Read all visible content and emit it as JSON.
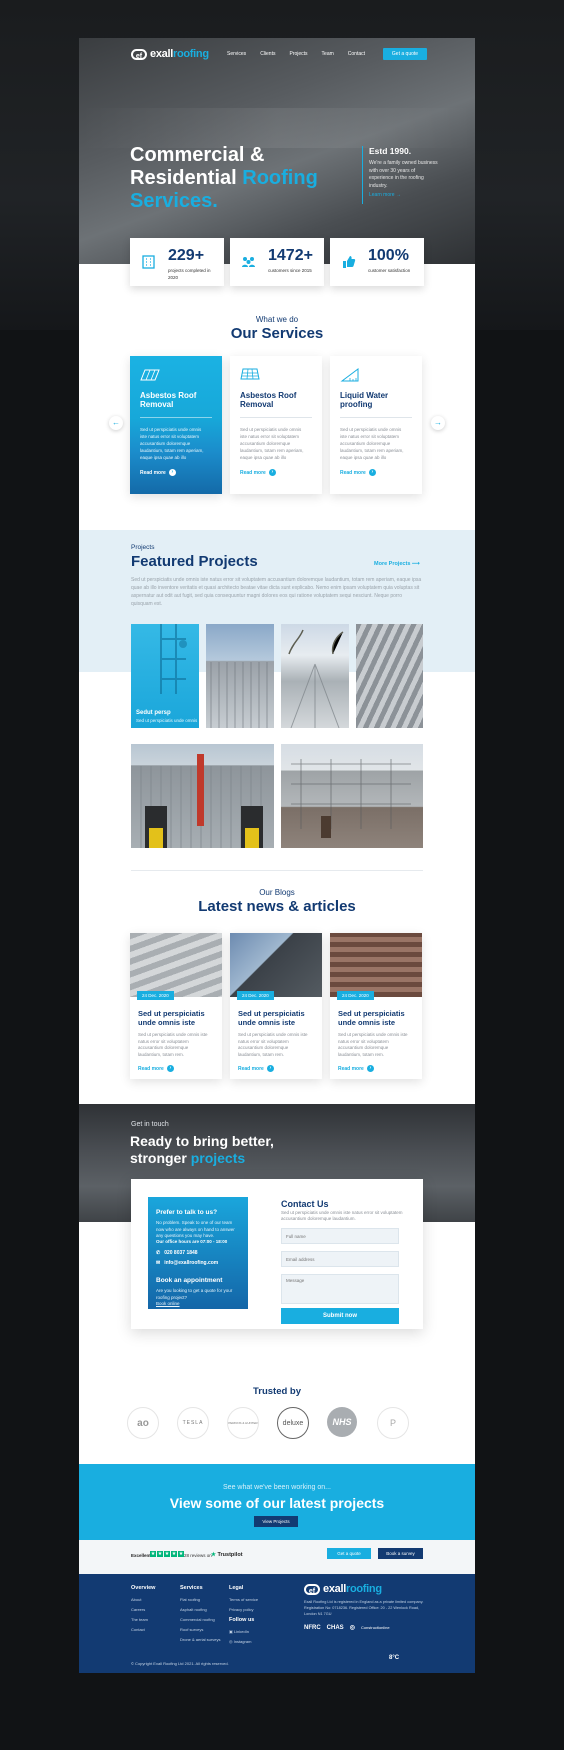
{
  "nav": {
    "logo_mark": "ef",
    "logo_main": "exall",
    "logo_accent": "roofing",
    "links": [
      "Services",
      "Clients",
      "Projects",
      "Team",
      "Contact"
    ],
    "cta": "Get a quote"
  },
  "hero": {
    "line1": "Commercial &",
    "line2a": "Residential ",
    "line2b": "Roofing",
    "line3": "Services.",
    "estd_title": "Estd 1990.",
    "estd_text": "We're a family owned business with over 30 years of experience in the roofing industry.",
    "estd_link": "Learn more →"
  },
  "stats": [
    {
      "num": "229+",
      "label": "projects completed in 2020"
    },
    {
      "num": "1472+",
      "label": "customers since 2015"
    },
    {
      "num": "100%",
      "label": "customer satisfaction"
    }
  ],
  "services": {
    "sub": "What we do",
    "title": "Our Services",
    "cards": [
      {
        "title": "Asbestos Roof Removal",
        "text": "Sed ut perspiciatis unde omnis iste natus error sit voluptatem accusantium doloremque laudantium, totam rem aperiam, eaque ipsa quae ab illo",
        "more": "Read more"
      },
      {
        "title": "Asbestos Roof Removal",
        "text": "Sed ut perspiciatis unde omnis iste natus error sit voluptatem accusantium doloremque laudantium, totam rem aperiam, eaque ipsa quae ab illo",
        "more": "Read more"
      },
      {
        "title": "Liquid Water proofing",
        "text": "Sed ut perspiciatis unde omnis iste natus error sit voluptatem accusantium doloremque laudantium, totam rem aperiam, eaque ipsa quae ab illo",
        "more": "Read more"
      }
    ],
    "prev": "←",
    "next": "→"
  },
  "projects": {
    "label": "Projects",
    "title": "Featured Projects",
    "more": "More Projects  ⟶",
    "desc": "Sed ut perspiciatis unde omnis iste natus error sit voluptatem accusantium doloremque laudantium, totam rem aperiam, eaque ipsa quae ab illo inventore veritatis et quasi architecto beatae vitae dicta sunt explicabo. Nemo enim ipsam voluptatem quia voluptas sit aspernatur aut odit aut fugit, sed quia consequuntur magni dolores eos qui ratione voluptatem sequi nesciunt. Neque porro quisquam est.",
    "highlight_title": "Sedut persp",
    "highlight_text": "Sed ut perspiciatis unde omnis"
  },
  "blogs": {
    "sub": "Our Blogs",
    "title": "Latest news & articles",
    "posts": [
      {
        "date": "24 Dec. 2020",
        "title": "Sed ut perspiciatis unde omnis iste",
        "text": "Sed ut perspiciatis unde omnis iste natus error sit voluptatem accusantium doloremque laudantium, totam rem.",
        "more": "Read more"
      },
      {
        "date": "24 Dec. 2020",
        "title": "Sed ut perspiciatis unde omnis iste",
        "text": "Sed ut perspiciatis unde omnis iste natus error sit voluptatem accusantium doloremque laudantium, totam rem.",
        "more": "Read more"
      },
      {
        "date": "24 Dec. 2020",
        "title": "Sed ut perspiciatis unde omnis iste",
        "text": "Sed ut perspiciatis unde omnis iste natus error sit voluptatem accusantium doloremque laudantium, totam rem.",
        "more": "Read more"
      }
    ]
  },
  "contact": {
    "sub": "Get in touch",
    "title_a": "Ready to bring better,",
    "title_b": "stronger ",
    "title_c": "projects",
    "blue_h1": "Prefer to talk to us?",
    "blue_t1": "No problem. Speak to one of our team now who are always on hand to answer any questions you may have.",
    "blue_hours": "Our office hours are 07:00 - 18:00",
    "phone": "020 8037 1848",
    "email": "info@exallroofing.com",
    "blue_h2": "Book an appointment",
    "blue_t2": "Are you looking to get a quote for your roofing project?",
    "book_link": "Book online",
    "form_title": "Contact Us",
    "form_desc": "Sed ut perspiciatis unde omnis iste natus error sit voluptatem accusantium doloremque laudantium.",
    "ph_name": "Full name",
    "ph_email": "Email address",
    "ph_message": "Message",
    "submit": "Submit now"
  },
  "trusted": {
    "title": "Trusted by",
    "logos": [
      "ao",
      "TESLA",
      "PERKINS & HUNTER",
      "deluxe",
      "NHS",
      "P"
    ]
  },
  "cta": {
    "sub": "See what we've been working on...",
    "title": "View some of our latest projects",
    "button": "View Projects"
  },
  "trustbar": {
    "excellent": "Excellent",
    "reviews": "28 reviews on",
    "logo_a": "★ ",
    "logo_b": "Trustpilot",
    "btn_quote": "Get a quote",
    "btn_survey": "Book a survey"
  },
  "footer": {
    "cols": [
      {
        "title": "Overview",
        "items": [
          "About",
          "Careers",
          "The team",
          "Contact"
        ]
      },
      {
        "title": "Services",
        "items": [
          "Flat roofing",
          "Asphalt roofing",
          "Commercial roofing",
          "Roof surveys",
          "Drone & aerial surveys"
        ]
      },
      {
        "title": "Legal",
        "items": [
          "Terms of service",
          "Privacy policy"
        ]
      }
    ],
    "follow_title": "Follow us",
    "social": [
      "LinkedIn",
      "Instagram"
    ],
    "company_text": "Exall Roofing Ltd is registered in England as a private limited company. Registration No: 0718236. Registered Office: 20 - 22 Wenlock Road, London N1 7GU",
    "badges": [
      "NFRC",
      "CHAS",
      "◎",
      "Constructionline"
    ],
    "copyright": "© Copyright Exall Roofing Ltd 2021. All rights reserved.",
    "weather": "8°C"
  },
  "colors": {
    "brand_blue": "#19aee0",
    "navy": "#123a72"
  }
}
